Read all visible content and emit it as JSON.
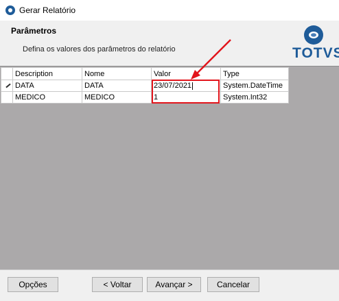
{
  "window": {
    "title": "Gerar Relatório"
  },
  "header": {
    "title": "Parâmetros",
    "subtitle": "Defina os valores dos parâmetros do relatório",
    "logo_text": "TOTVS",
    "brand_color": "#1f5c99"
  },
  "grid": {
    "columns": [
      "Description",
      "Nome",
      "Valor",
      "Type"
    ],
    "rows": [
      {
        "description": "DATA",
        "nome": "DATA",
        "valor": "23/07/2021",
        "type": "System.DateTime",
        "editing": true
      },
      {
        "description": "MEDICO",
        "nome": "MEDICO",
        "valor": "1",
        "type": "System.Int32",
        "editing": false
      }
    ]
  },
  "annotation": {
    "highlight_color": "#e2141b"
  },
  "buttons": {
    "options": "Opções",
    "back": "< Voltar",
    "next": "Avançar >",
    "cancel": "Cancelar"
  }
}
